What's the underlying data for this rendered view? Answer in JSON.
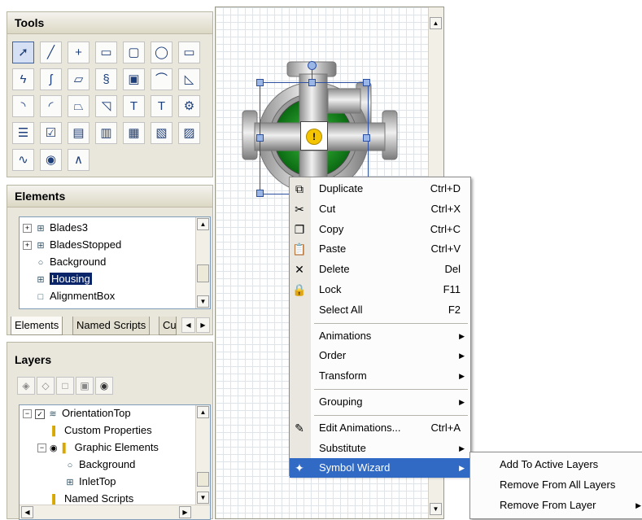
{
  "tools": {
    "title": "Tools",
    "rows": [
      [
        {
          "icon": "arrow-pointer-icon",
          "g": "➚"
        },
        {
          "icon": "line-tool-icon",
          "g": "╱"
        },
        {
          "icon": "cross-tool-icon",
          "g": "+"
        },
        {
          "icon": "rectangle-tool-icon",
          "g": "▭"
        },
        {
          "icon": "rounded-rectangle-tool-icon",
          "g": "▢"
        },
        {
          "icon": "ellipse-tool-icon",
          "g": "◯"
        },
        {
          "icon": "raised-rectangle-tool-icon",
          "g": "▭"
        }
      ],
      [
        {
          "icon": "polyline-tool-icon",
          "g": "ϟ"
        },
        {
          "icon": "curve-tool-icon",
          "g": "ʃ"
        },
        {
          "icon": "polygon-tool-icon",
          "g": "▱"
        },
        {
          "icon": "closed-curve-tool-icon",
          "g": "§"
        },
        {
          "icon": "image-tool-icon",
          "g": "▣"
        },
        {
          "icon": "arc-tool-icon",
          "g": "⌒"
        },
        {
          "icon": "pie-tool-icon",
          "g": "◺"
        }
      ],
      [
        {
          "icon": "arc2-tool-icon",
          "g": "◝"
        },
        {
          "icon": "chord-tool-icon",
          "g": "◜"
        },
        {
          "icon": "polygon2-tool-icon",
          "g": "⏢"
        },
        {
          "icon": "wedge-tool-icon",
          "g": "◹"
        },
        {
          "icon": "text-tool-icon",
          "g": "T"
        },
        {
          "icon": "text-box-tool-icon",
          "g": "T"
        },
        {
          "icon": "embedded-symbol-tool-icon",
          "g": "⚙"
        }
      ],
      [
        {
          "icon": "list-tool-icon",
          "g": "☰"
        },
        {
          "icon": "checkbox-tool-icon",
          "g": "☑"
        },
        {
          "icon": "edit-box-tool-icon",
          "g": "▤"
        },
        {
          "icon": "combo-box-tool-icon",
          "g": "▥"
        },
        {
          "icon": "calendar-tool-icon",
          "g": "▦"
        },
        {
          "icon": "datetime-tool-icon",
          "g": "▧"
        },
        {
          "icon": "listbox-tool-icon",
          "g": "▨"
        }
      ],
      [
        {
          "icon": "pipe-tool-icon",
          "g": "∿"
        },
        {
          "icon": "gauge-tool-icon",
          "g": "◉"
        },
        {
          "icon": "trend-tool-icon",
          "g": "∧"
        }
      ]
    ]
  },
  "elements": {
    "title": "Elements",
    "items": [
      {
        "label": "Blades3",
        "expander": "+",
        "icon": "group-icon"
      },
      {
        "label": "BladesStopped",
        "expander": "+",
        "icon": "group-icon"
      },
      {
        "label": "Background",
        "expander": "",
        "icon": "ellipse-icon"
      },
      {
        "label": "Housing",
        "expander": "",
        "icon": "group-icon",
        "selected": true
      },
      {
        "label": "AlignmentBox",
        "expander": "",
        "icon": "rectangle-icon"
      }
    ],
    "tabs": [
      "Elements",
      "Named Scripts",
      "Cus"
    ]
  },
  "layers": {
    "title": "Layers",
    "items": [
      {
        "label": "OrientationTop",
        "indent": 0,
        "expander": "−",
        "icon": "layer-icon",
        "checked": true
      },
      {
        "label": "Custom Properties",
        "indent": 1,
        "expander": "",
        "icon": "folder-icon"
      },
      {
        "label": "Graphic Elements",
        "indent": 1,
        "expander": "−",
        "icon": "folder-icon",
        "eye": true
      },
      {
        "label": "Background",
        "indent": 2,
        "expander": "",
        "icon": "ellipse-icon"
      },
      {
        "label": "InletTop",
        "indent": 2,
        "expander": "",
        "icon": "group-icon"
      },
      {
        "label": "Named Scripts",
        "indent": 1,
        "expander": "",
        "icon": "folder-icon"
      }
    ]
  },
  "context_menu": {
    "items": [
      {
        "type": "item",
        "label": "Duplicate",
        "shortcut": "Ctrl+D",
        "icon": "duplicate-icon",
        "g": "⧉"
      },
      {
        "type": "item",
        "label": "Cut",
        "shortcut": "Ctrl+X",
        "icon": "scissors-icon",
        "g": "✂"
      },
      {
        "type": "item",
        "label": "Copy",
        "shortcut": "Ctrl+C",
        "icon": "copy-icon",
        "g": "❐"
      },
      {
        "type": "item",
        "label": "Paste",
        "shortcut": "Ctrl+V",
        "icon": "paste-icon",
        "g": "📋"
      },
      {
        "type": "item",
        "label": "Delete",
        "shortcut": "Del",
        "icon": "delete-x-icon",
        "g": "✕"
      },
      {
        "type": "item",
        "label": "Lock",
        "shortcut": "F11",
        "icon": "lock-icon",
        "g": "🔒"
      },
      {
        "type": "item",
        "label": "Select All",
        "shortcut": "F2",
        "icon": "",
        "g": ""
      },
      {
        "type": "sep"
      },
      {
        "type": "sub",
        "label": "Animations",
        "shortcut": "",
        "icon": "",
        "g": ""
      },
      {
        "type": "sub",
        "label": "Order",
        "shortcut": "",
        "icon": "",
        "g": ""
      },
      {
        "type": "sub",
        "label": "Transform",
        "shortcut": "",
        "icon": "",
        "g": ""
      },
      {
        "type": "sep"
      },
      {
        "type": "sub",
        "label": "Grouping",
        "shortcut": "",
        "icon": "",
        "g": ""
      },
      {
        "type": "sep"
      },
      {
        "type": "item",
        "label": "Edit Animations...",
        "shortcut": "Ctrl+A",
        "icon": "edit-animations-icon",
        "g": "✎"
      },
      {
        "type": "sub",
        "label": "Substitute",
        "shortcut": "",
        "icon": "",
        "g": ""
      },
      {
        "type": "sub",
        "label": "Symbol Wizard",
        "shortcut": "",
        "icon": "symbol-wizard-icon",
        "g": "✦",
        "highlighted": true
      }
    ]
  },
  "submenu": {
    "items": [
      {
        "label": "Add To Active Layers",
        "arrow": false
      },
      {
        "label": "Remove From All Layers",
        "arrow": false
      },
      {
        "label": "Remove From Layer",
        "arrow": true
      }
    ]
  }
}
